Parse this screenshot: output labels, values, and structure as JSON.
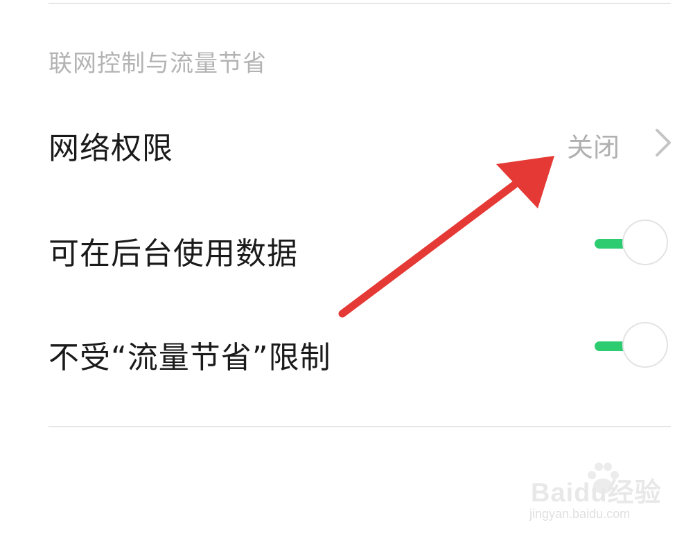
{
  "section": {
    "title": "联网控制与流量节省"
  },
  "network_permission": {
    "label": "网络权限",
    "value": "关闭"
  },
  "background_data": {
    "label": "可在后台使用数据",
    "enabled": true
  },
  "unrestricted_data": {
    "label": "不受“流量节省”限制",
    "enabled": true
  },
  "colors": {
    "toggle_on": "#2ecc71",
    "annotation_arrow": "#e53935",
    "section_title": "#b3b3b3",
    "value_text": "#b0b0b0"
  },
  "icons": {
    "chevron": "chevron-right-icon",
    "arrow": "annotation-arrow"
  },
  "watermark": {
    "logo": "Baidu经验",
    "url": "jingyan.baidu.com"
  }
}
